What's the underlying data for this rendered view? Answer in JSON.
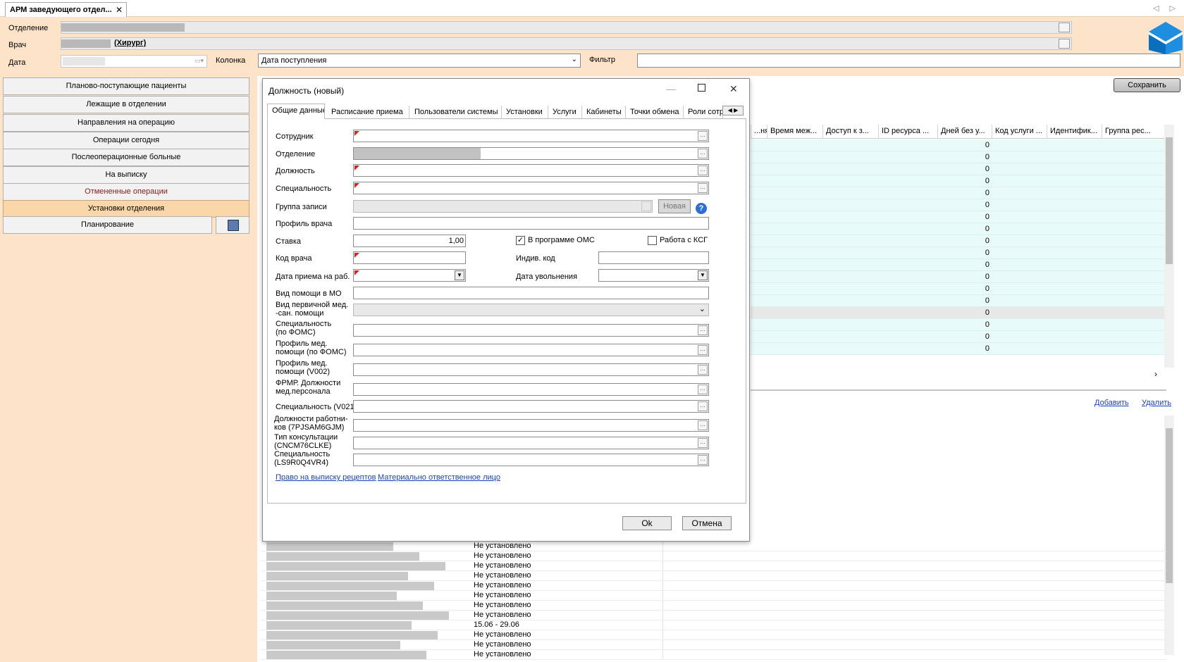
{
  "tab": {
    "title": "АРМ заведующего отдел...",
    "close": "✕",
    "nav": "◁ ▷"
  },
  "header": {
    "department_label": "Отделение",
    "doctor_label": "Врач",
    "doctor_value": "(Хирург)",
    "date_label": "Дата",
    "column_label": "Колонка",
    "column_value": "Дата поступления",
    "filter_label": "Фильтр",
    "filter_value": ""
  },
  "nav": {
    "items": [
      "Планово-поступающие пациенты",
      "Лежащие в отделении",
      "Направления на операцию",
      "Операции сегодня",
      "Послеоперационные больные",
      "На выписку",
      "Отмененные операции",
      "Установки отделения",
      "Планирование"
    ],
    "active": "Установки отделения"
  },
  "toolbar": {
    "save": "Сохранить"
  },
  "grid": {
    "headers": [
      "...ня...",
      "Время меж...",
      "Доступ к з...",
      "ID ресурса ...",
      "Дней без у...",
      "Код услуги ...",
      "Идентифик...",
      "Группа рес..."
    ],
    "zero_values": [
      "0",
      "0",
      "0",
      "0",
      "0",
      "0",
      "0",
      "0",
      "0",
      "0",
      "0",
      "0",
      "0",
      "0",
      "0",
      "0",
      "0",
      "0"
    ]
  },
  "lower": {
    "add": "Добавить",
    "delete": "Удалить",
    "status_values": [
      "Не установлено",
      "Не установлено",
      "Не установлено",
      "Не установлено",
      "Не установлено",
      "Не установлено",
      "Не установлено",
      "Не установлено",
      "15.06 - 29.06",
      "Не установлено",
      "Не установлено",
      "Не установлено"
    ]
  },
  "dialog": {
    "title": "Должность (новый)",
    "tabs": [
      "Общие данные",
      "Расписание приема",
      "Пользователи системы",
      "Установки",
      "Услуги",
      "Кабинеты",
      "Точки обмена",
      "Роли сотр"
    ],
    "labels": {
      "employee": "Сотрудник",
      "department": "Отделение",
      "position": "Должность",
      "specialty": "Специальность",
      "record_group": "Группа записи",
      "new_button": "Новая",
      "doctor_profile": "Профиль врача",
      "rate": "Ставка",
      "rate_value": "1,00",
      "oms": "В программе ОМС",
      "ksg": "Работа с КСГ",
      "doctor_code": "Код врача",
      "indiv_code": "Индив. код",
      "hire_date": "Дата приема на раб.",
      "fire_date": "Дата увольнения",
      "help_type": "Вид помощи в МО",
      "primary_help_1": "Вид первичной мед.",
      "primary_help_2": "-сан. помощи",
      "spec_foms_1": "Специальность",
      "spec_foms_2": "(по ФОМС)",
      "profile_foms_1": "Профиль  мед.",
      "profile_foms_2": "помощи (по ФОМС)",
      "profile_v002_1": "Профиль  мед.",
      "profile_v002_2": "помощи (V002)",
      "frmr_1": "ФРМР. Должности",
      "frmr_2": "мед.персонала",
      "spec_v021": "Специальность (V021)",
      "workers_1": "Должности работни-",
      "workers_2": "ков (7PJSAM6GJM)",
      "consult_1": "Тип консультации",
      "consult_2": "(CNCM76CLKE)",
      "spec_ls_1": "Специальность",
      "spec_ls_2": "(LS9R0Q4VR4)"
    },
    "links": {
      "recipes": "Право на выписку рецептов",
      "responsible": "Материально ответственное лицо"
    },
    "ok": "Ok",
    "cancel": "Отмена",
    "oms_checked": true,
    "ksg_checked": false
  }
}
